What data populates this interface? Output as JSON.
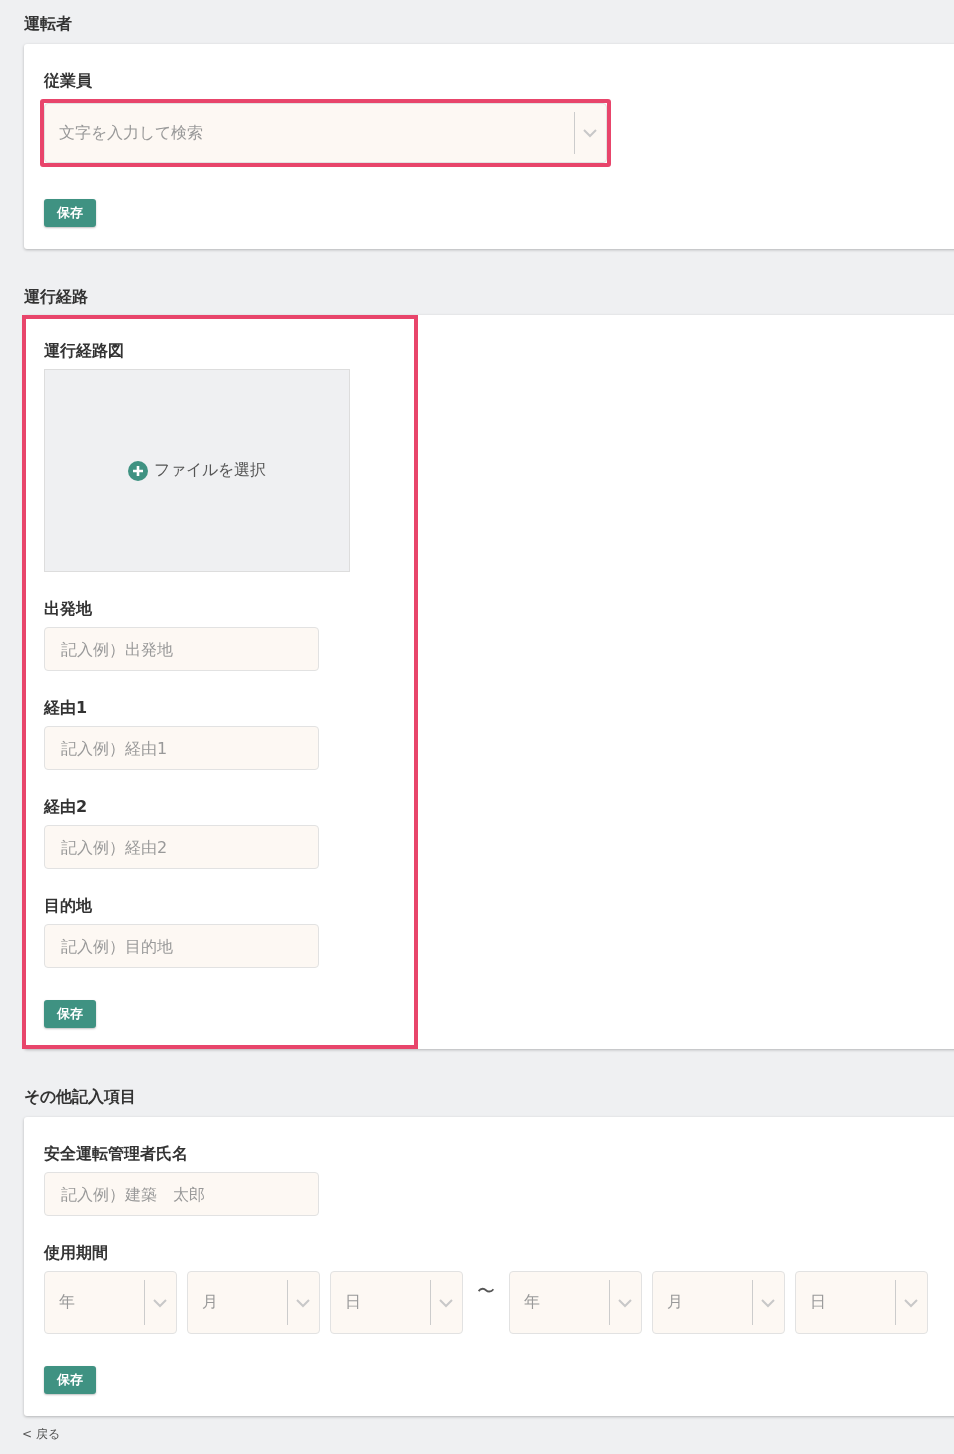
{
  "sections": [
    {
      "kind": "driver",
      "title": "運転者",
      "fields": [
        {
          "kind": "select",
          "label": "従業員",
          "placeholder": "文字を入力して検索",
          "highlighted": true
        }
      ],
      "save_button": "保存"
    },
    {
      "kind": "route",
      "title": "運行経路",
      "highlighted": true,
      "fields": [
        {
          "kind": "upload",
          "label": "運行経路図",
          "button": "ファイルを選択"
        },
        {
          "kind": "text",
          "label": "出発地",
          "placeholder": "記入例）出発地"
        },
        {
          "kind": "text",
          "label": "経由1",
          "placeholder": "記入例）経由1"
        },
        {
          "kind": "text",
          "label": "経由2",
          "placeholder": "記入例）経由2"
        },
        {
          "kind": "text",
          "label": "目的地",
          "placeholder": "記入例）目的地"
        }
      ],
      "save_button": "保存"
    },
    {
      "kind": "other",
      "title": "その他記入項目",
      "fields": [
        {
          "kind": "text",
          "label": "安全運転管理者氏名",
          "placeholder": "記入例）建築　太郎"
        },
        {
          "kind": "period",
          "label": "使用期間",
          "from": [
            {
              "placeholder": "年"
            },
            {
              "placeholder": "月"
            },
            {
              "placeholder": "日"
            }
          ],
          "separator": "〜",
          "to": [
            {
              "placeholder": "年"
            },
            {
              "placeholder": "月"
            },
            {
              "placeholder": "日"
            }
          ]
        }
      ],
      "save_button": "保存"
    }
  ],
  "back_link": "< 戻る"
}
